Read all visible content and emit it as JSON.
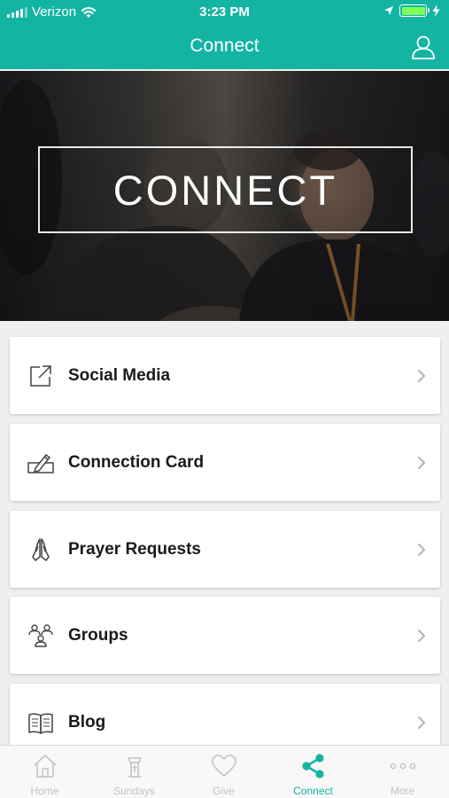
{
  "status_bar": {
    "carrier": "Verizon",
    "time": "3:23 PM"
  },
  "nav": {
    "title": "Connect"
  },
  "hero": {
    "text": "CONNECT"
  },
  "menu": {
    "items": [
      {
        "label": "Social Media",
        "icon": "external-link-icon"
      },
      {
        "label": "Connection Card",
        "icon": "pencil-card-icon"
      },
      {
        "label": "Prayer Requests",
        "icon": "praying-hands-icon"
      },
      {
        "label": "Groups",
        "icon": "people-group-icon"
      },
      {
        "label": "Blog",
        "icon": "open-book-icon"
      }
    ]
  },
  "tabs": [
    {
      "label": "Home",
      "icon": "house-icon"
    },
    {
      "label": "Sundays",
      "icon": "pulpit-icon"
    },
    {
      "label": "Give",
      "icon": "heart-icon"
    },
    {
      "label": "Connect",
      "icon": "share-icon",
      "active": true
    },
    {
      "label": "More",
      "icon": "more-dots-icon"
    }
  ],
  "colors": {
    "accent": "#14b4a3",
    "inactive_tab": "#c3c3c3",
    "battery": "#7fff5a"
  }
}
